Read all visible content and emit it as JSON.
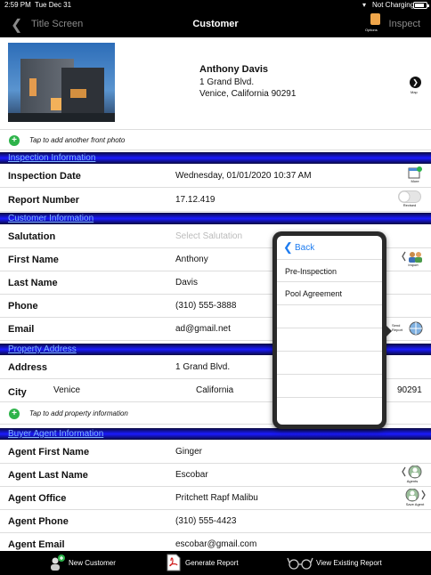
{
  "status_bar": {
    "time": "2:59 PM",
    "date": "Tue Dec 31",
    "charging": "Not Charging",
    "battery_level": 0.85
  },
  "nav": {
    "back_label": "Title Screen",
    "title": "Customer",
    "options_label": "Options",
    "inspect_label": "Inspect"
  },
  "customer": {
    "name": "Anthony Davis",
    "address1": "1 Grand Blvd.",
    "address2": "Venice, California 90291",
    "map_label": "Map",
    "add_photo": "Tap to add another front photo"
  },
  "inspection": {
    "header": "Inspection Information",
    "date_label": "Inspection Date",
    "date_value": "Wednesday, 01/01/2020 10:37 AM",
    "report_label": "Report Number",
    "report_value": "17.12.419",
    "more_label": "More",
    "revised_label": "Revised",
    "revised_on": false
  },
  "customer_info": {
    "header": "Customer Information",
    "salutation_label": "Salutation",
    "salutation_placeholder": "Select Salutation",
    "first_label": "First Name",
    "first_value": "Anthony",
    "last_label": "Last Name",
    "last_value": "Davis",
    "phone_label": "Phone",
    "phone_value": "(310) 555-3888",
    "email_label": "Email",
    "email_value": "ad@gmail.net",
    "import_label": "Import",
    "send_report_label": "Send Report"
  },
  "property": {
    "header": "Property Address",
    "address_label": "Address",
    "address_value": "1 Grand Blvd.",
    "city_label": "City",
    "city_value": "Venice",
    "state_value": "California",
    "zip_value": "90291",
    "add_info": "Tap to add property information"
  },
  "buyer_agent": {
    "header": "Buyer Agent Information",
    "first_label": "Agent First Name",
    "first_value": "Ginger",
    "last_label": "Agent Last Name",
    "last_value": "Escobar",
    "office_label": "Agent Office",
    "office_value": "Pritchett Rapf Malibu",
    "phone_label": "Agent Phone",
    "phone_value": "(310) 555-4423",
    "email_label": "Agent Email",
    "email_value": "escobar@gmail.com",
    "agents_label": "Agents",
    "save_agent_label": "Save Agent"
  },
  "popover": {
    "back_label": "Back",
    "items": [
      "Pre-Inspection",
      "Pool Agreement"
    ]
  },
  "toolbar": {
    "new_customer": "New Customer",
    "generate_report": "Generate Report",
    "view_existing": "View Existing Report"
  }
}
